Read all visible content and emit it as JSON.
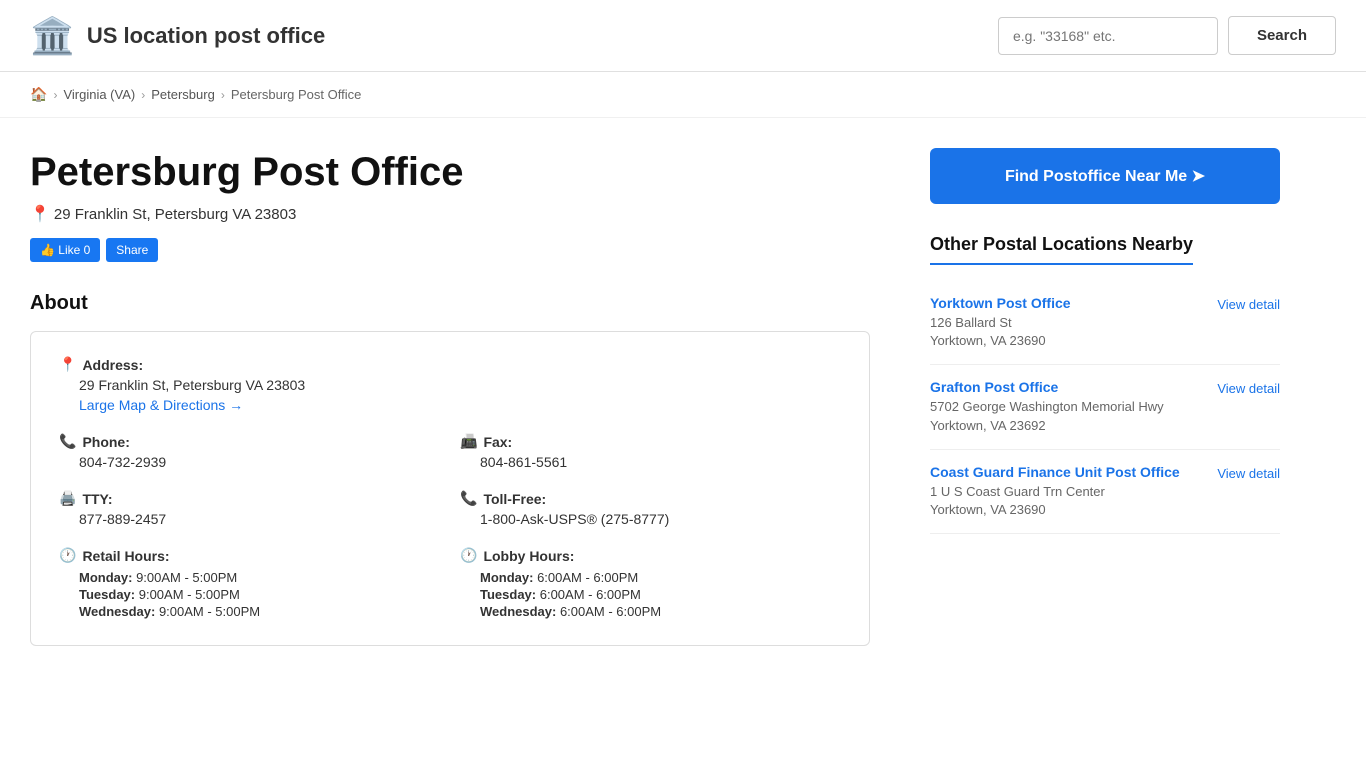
{
  "header": {
    "logo_emoji": "🏛️",
    "site_title": "US location post office",
    "search_placeholder": "e.g. \"33168\" etc.",
    "search_label": "Search"
  },
  "breadcrumb": {
    "home": "🏠",
    "state": "Virginia (VA)",
    "city": "Petersburg",
    "current": "Petersburg Post Office"
  },
  "page": {
    "title": "Petersburg Post Office",
    "address_pin": "📍",
    "address": "29 Franklin St, Petersburg VA 23803",
    "fb_like": "👍 Like 0",
    "fb_share": "Share"
  },
  "about": {
    "title": "About"
  },
  "info": {
    "address_label": "Address:",
    "address_value": "29 Franklin St, Petersburg VA 23803",
    "map_link": "Large Map & Directions →",
    "phone_label": "Phone:",
    "phone_value": "804-732-2939",
    "fax_label": "Fax:",
    "fax_value": "804-861-5561",
    "tty_label": "TTY:",
    "tty_value": "877-889-2457",
    "tollfree_label": "Toll-Free:",
    "tollfree_value": "1-800-Ask-USPS® (275-8777)",
    "retail_hours_label": "Retail Hours:",
    "retail_hours": [
      {
        "day": "Monday:",
        "time": "9:00AM - 5:00PM"
      },
      {
        "day": "Tuesday:",
        "time": "9:00AM - 5:00PM"
      },
      {
        "day": "Wednesday:",
        "time": "9:00AM - 5:00PM"
      }
    ],
    "lobby_hours_label": "Lobby Hours:",
    "lobby_hours": [
      {
        "day": "Monday:",
        "time": "6:00AM - 6:00PM"
      },
      {
        "day": "Tuesday:",
        "time": "6:00AM - 6:00PM"
      },
      {
        "day": "Wednesday:",
        "time": "6:00AM - 6:00PM"
      }
    ]
  },
  "sidebar": {
    "find_btn_label": "Find Postoffice Near Me ➤",
    "nearby_title": "Other Postal Locations Nearby",
    "nearby_items": [
      {
        "name": "Yorktown Post Office",
        "address": "126 Ballard St",
        "city_state": "Yorktown, VA 23690",
        "view_label": "View detail"
      },
      {
        "name": "Grafton Post Office",
        "address": "5702 George Washington Memorial Hwy",
        "city_state": "Yorktown, VA 23692",
        "view_label": "View detail"
      },
      {
        "name": "Coast Guard Finance Unit Post Office",
        "address": "1 U S Coast Guard Trn Center",
        "city_state": "Yorktown, VA 23690",
        "view_label": "View detail"
      }
    ]
  }
}
